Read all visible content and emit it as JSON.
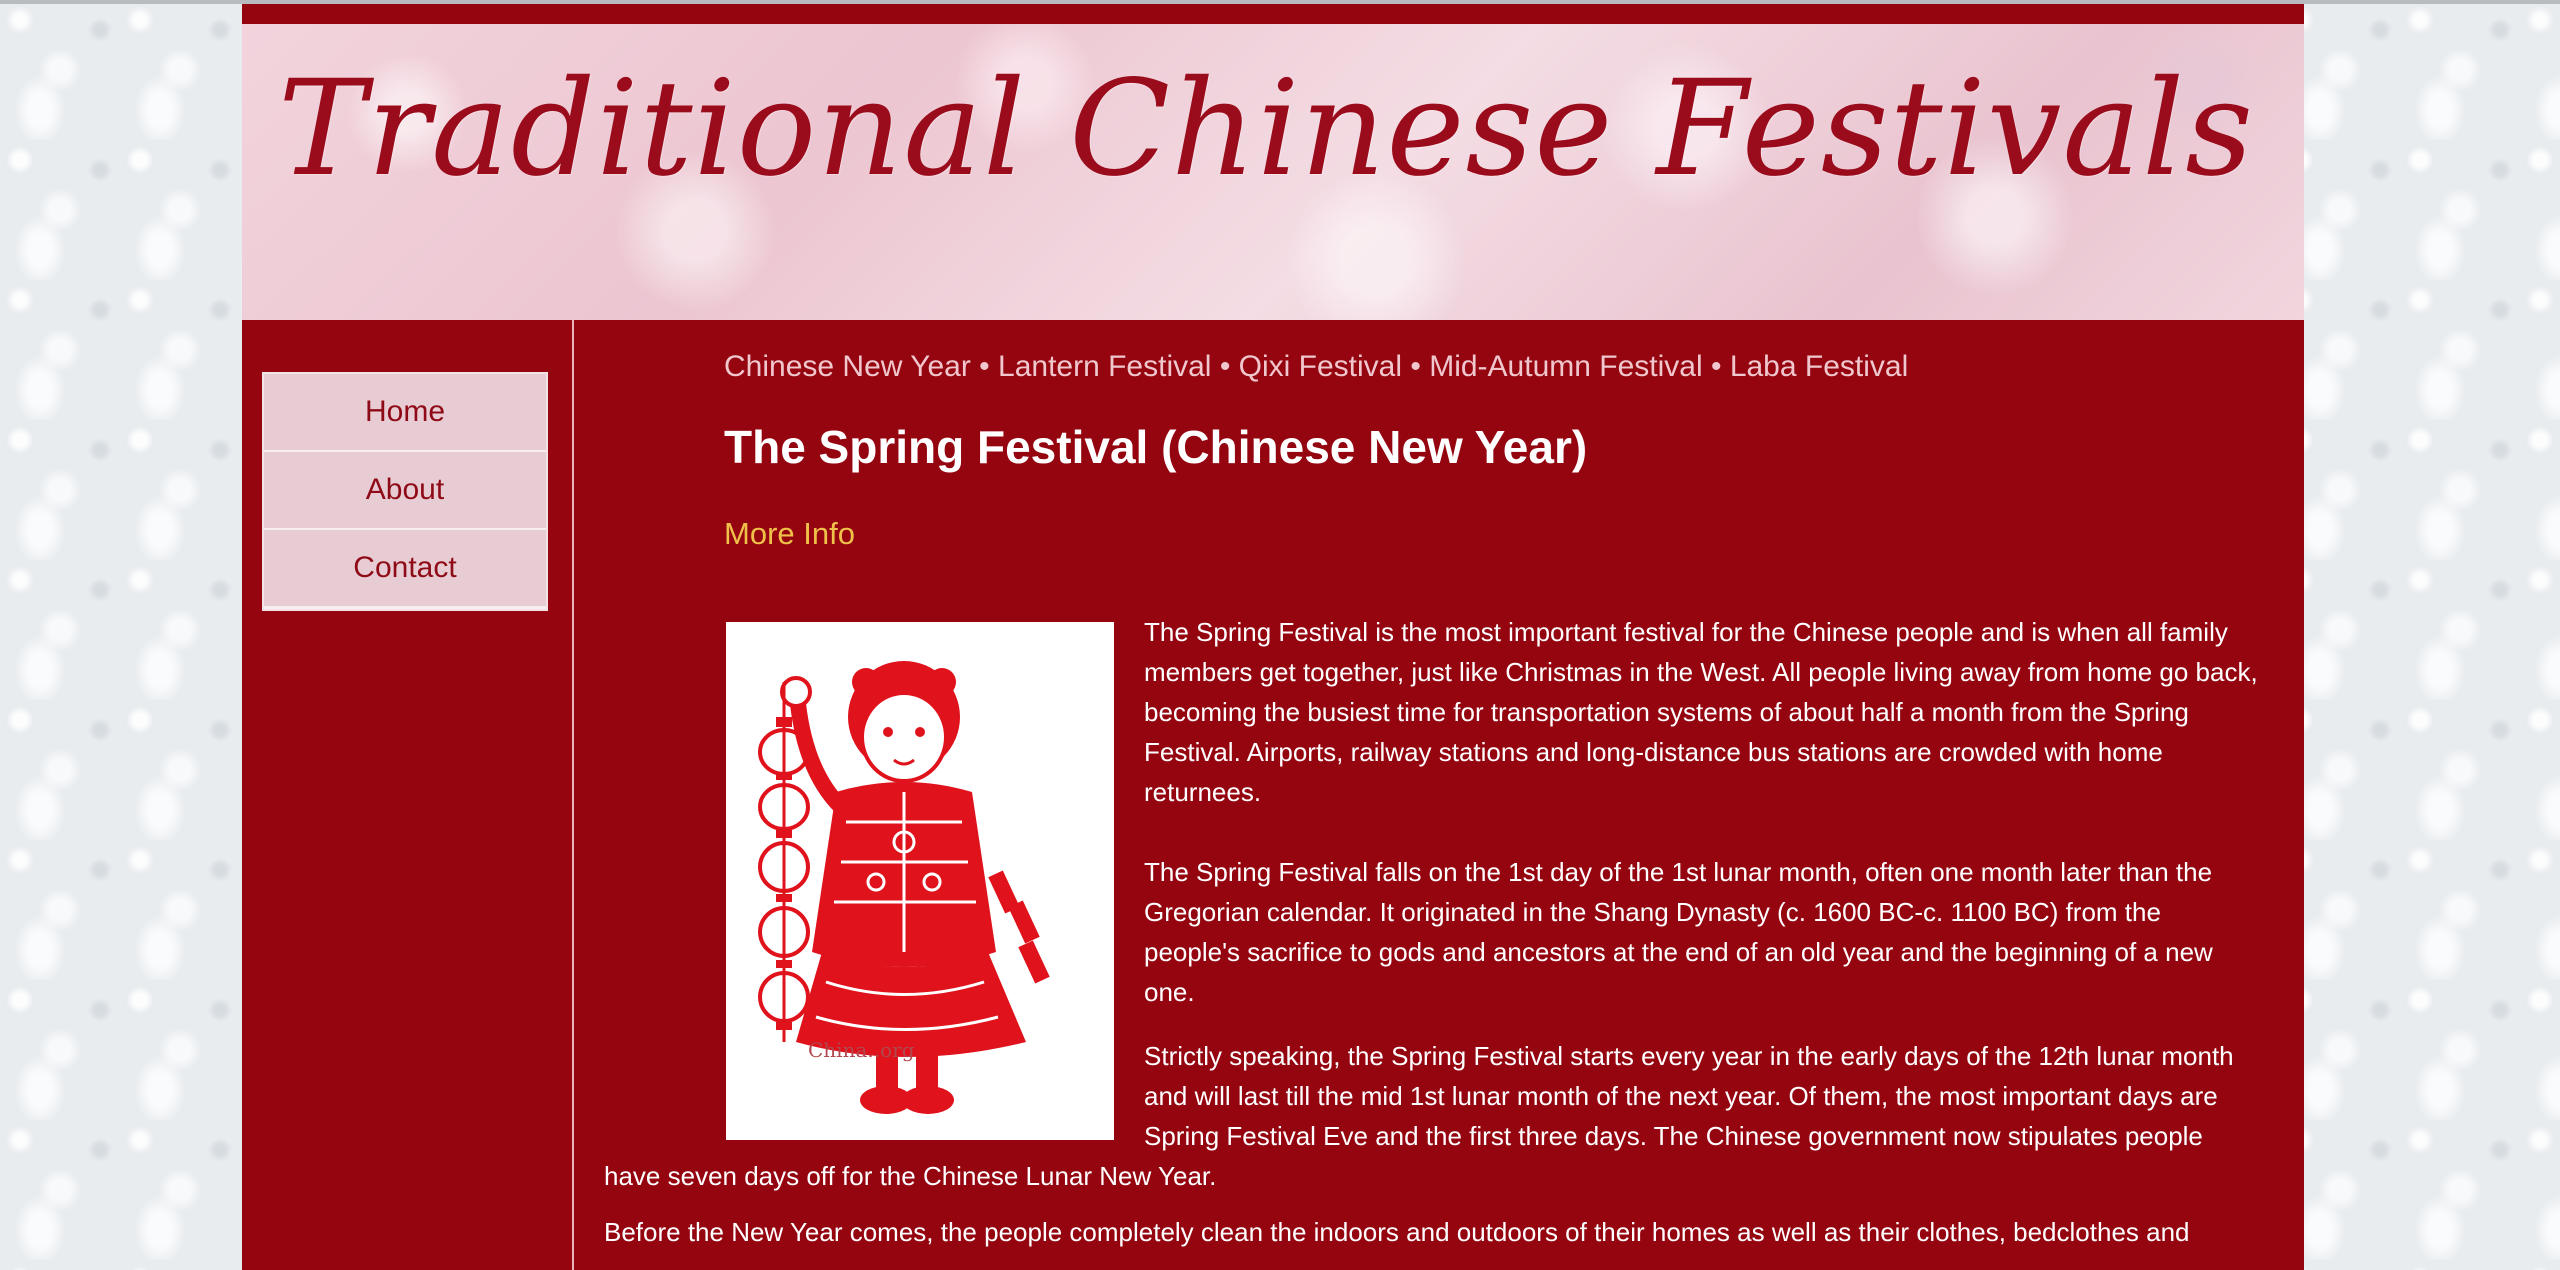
{
  "site": {
    "title": "Traditional Chinese Festivals"
  },
  "nav": {
    "items": [
      {
        "label": "Home"
      },
      {
        "label": "About"
      },
      {
        "label": "Contact"
      }
    ]
  },
  "festival_links": {
    "items": [
      {
        "label": "Chinese New Year"
      },
      {
        "label": "Lantern Festival"
      },
      {
        "label": "Qixi Festival"
      },
      {
        "label": "Mid-Autumn Festival"
      },
      {
        "label": "Laba Festival"
      }
    ],
    "separator": "•"
  },
  "main": {
    "heading": "The Spring Festival (Chinese New Year)",
    "more_info": "More Info",
    "image": {
      "caption_text": "China..org",
      "icon": "paper-cut-child-with-lanterns"
    },
    "paragraphs": [
      "The Spring Festival is the most important festival for the Chinese people and is when all family members get together, just like Christmas in the West. All people living away from home go back, becoming the busiest time for transportation systems of about half a month from the Spring Festival. Airports, railway stations and long-distance bus stations are crowded with home returnees.",
      "The Spring Festival falls on the 1st day of the 1st lunar month, often one month later than the Gregorian calendar. It originated in the Shang Dynasty (c. 1600 BC-c. 1100 BC) from the people's sacrifice to gods and ancestors at the end of an old year and the beginning of a new one.",
      "Strictly speaking, the Spring Festival starts every year in the early days of the 12th lunar month and will last till the mid 1st lunar month of the next year. Of them, the most important days are Spring Festival Eve and the first three days. The Chinese government now stipulates people have seven days off for the Chinese Lunar New Year.",
      "Before the New Year comes, the people completely clean the indoors and outdoors of their homes as well as their clothes, bedclothes and"
    ]
  },
  "colors": {
    "page_background": "#940510",
    "title_color": "#9a0b1b",
    "nav_background": "#e8ccd3",
    "link_color": "#f0c7cd",
    "more_info_color": "#efc04a",
    "text_color": "#ffffff"
  }
}
